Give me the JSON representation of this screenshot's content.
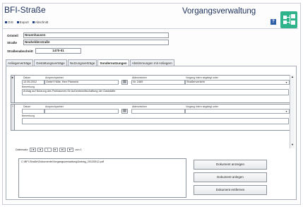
{
  "header": {
    "title": "BFI-Straße",
    "right_title": "Vorgangsverwaltung",
    "help_label": "?",
    "menu": [
      {
        "label": "GIS"
      },
      {
        "label": "Export"
      },
      {
        "label": "Abschnitt"
      }
    ]
  },
  "form": {
    "ortsteil_label": "Ortsteil",
    "ortsteil_value": "Neuenhausen",
    "strasse_label": "Straße",
    "strasse_value": "Neuhelderstraße",
    "abschnitt_label": "Straßenabschnitt",
    "abschnitt_value": "1470-01"
  },
  "tabs": [
    {
      "label": "Anliegerverträge",
      "active": false
    },
    {
      "label": "Gestattungsverträge",
      "active": false
    },
    {
      "label": "Nutzungsverträge",
      "active": false
    },
    {
      "label": "Sondernutzungen",
      "active": true
    },
    {
      "label": "Abstimmungen mit Anliegern",
      "active": false
    }
  ],
  "record_labels": {
    "datum": "Datum",
    "ansprechpartner": "Ansprechpartner",
    "aktenzeichen": "Aktenzeichen",
    "vorgang": "Vorgang intern abgelegt unter",
    "bemerkung": "Bemerkung"
  },
  "records": [
    {
      "datum": "12.05.2012",
      "ansprechpartner": "GmbH Hölle, Herr Pannenk",
      "aktenzeichen": "Nr. 2469",
      "vorgang": "Straßenverkehr",
      "bemerkung": "Antrag auf Nutzung des Parkraumes für Außenbewirtschaftung der Gaststätte"
    },
    {
      "datum": "",
      "ansprechpartner": "",
      "aktenzeichen": "",
      "vorgang": "",
      "bemerkung": ""
    }
  ],
  "nav": {
    "label": "Datensatz:",
    "first": "|◄",
    "prev": "◄",
    "current": "1",
    "next": "►",
    "last": "►|",
    "new": "►*",
    "of_text": "von 1"
  },
  "documents": {
    "path": "C:\\BFI-Straße\\Dokumente\\Vorgangsverwaltung\\Antrag_20120512.pdf",
    "btn_show": "Dokument anzeigen",
    "btn_add": "Dokument anlegen",
    "btn_remove": "Dokument entfernen"
  },
  "colors": {
    "title": "#1c2f5a",
    "logo": "#2eb38a",
    "help": "#2f5fa8"
  }
}
